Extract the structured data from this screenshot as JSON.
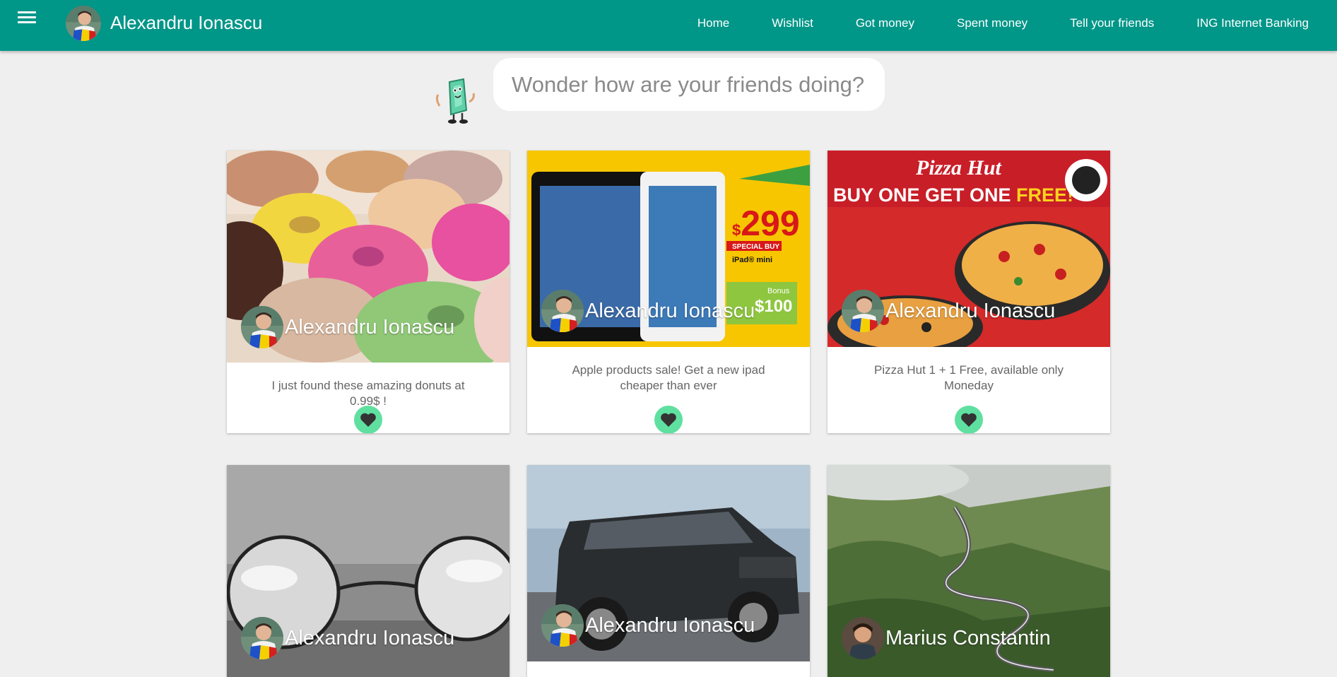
{
  "header": {
    "user_name": "Alexandru Ionascu",
    "nav": [
      "Home",
      "Wishlist",
      "Got money",
      "Spent money",
      "Tell your friends",
      "ING Internet Banking"
    ]
  },
  "search": {
    "placeholder": "Wonder how are your friends doing?"
  },
  "colors": {
    "primary": "#009688",
    "like": "#5fe0a0",
    "background": "#efefef"
  },
  "cards": [
    {
      "author": "Alexandru Ionascu",
      "text": "I just found these amazing donuts at 0.99$ !",
      "image": "donuts"
    },
    {
      "author": "Alexandru Ionascu",
      "text": "Apple products sale! Get a new ipad cheaper than ever",
      "image": "ipad-ad",
      "image_text": {
        "price_sign": "$",
        "price": "299",
        "badge": "SPECIAL BUY",
        "product": "iPad® mini",
        "bonus_label": "Bonus",
        "bonus_value": "$100"
      }
    },
    {
      "author": "Alexandru Ionascu",
      "text": "Pizza Hut 1 + 1 Free, available only Moneday",
      "image": "pizza-ad",
      "image_text": {
        "brand": "Pizza Hut",
        "headline_a": "BUY ONE GET ONE ",
        "headline_b": "FREE!"
      }
    },
    {
      "author": "Alexandru Ionascu",
      "text": "",
      "image": "glasses"
    },
    {
      "author": "Alexandru Ionascu",
      "text": "",
      "image": "car"
    },
    {
      "author": "Marius Constantin",
      "text": "",
      "image": "mountain-road"
    }
  ]
}
